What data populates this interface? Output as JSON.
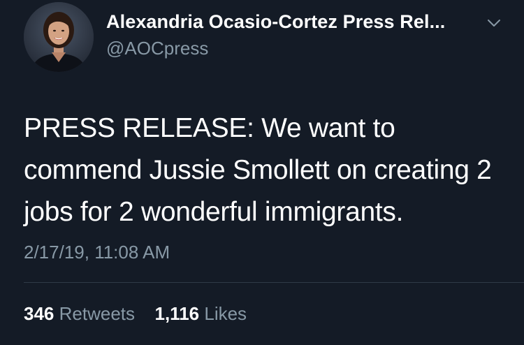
{
  "account": {
    "name": "Alexandria Ocasio-Cortez Press Rel...",
    "handle": "@AOCpress"
  },
  "tweet": {
    "text": "PRESS RELEASE: We want to commend Jussie Smollett on creating 2 jobs for 2 wonderful immigrants.",
    "timestamp": "2/17/19, 11:08 AM"
  },
  "stats": {
    "retweets_count": "346",
    "retweets_label": "Retweets",
    "likes_count": "1,116",
    "likes_label": "Likes"
  },
  "icons": {
    "menu": "chevron-down-icon",
    "avatar": "profile-photo"
  },
  "colors": {
    "background": "#141b26",
    "primary_text": "#ffffff",
    "secondary_text": "#8899a6",
    "divider": "#2f3a47"
  }
}
